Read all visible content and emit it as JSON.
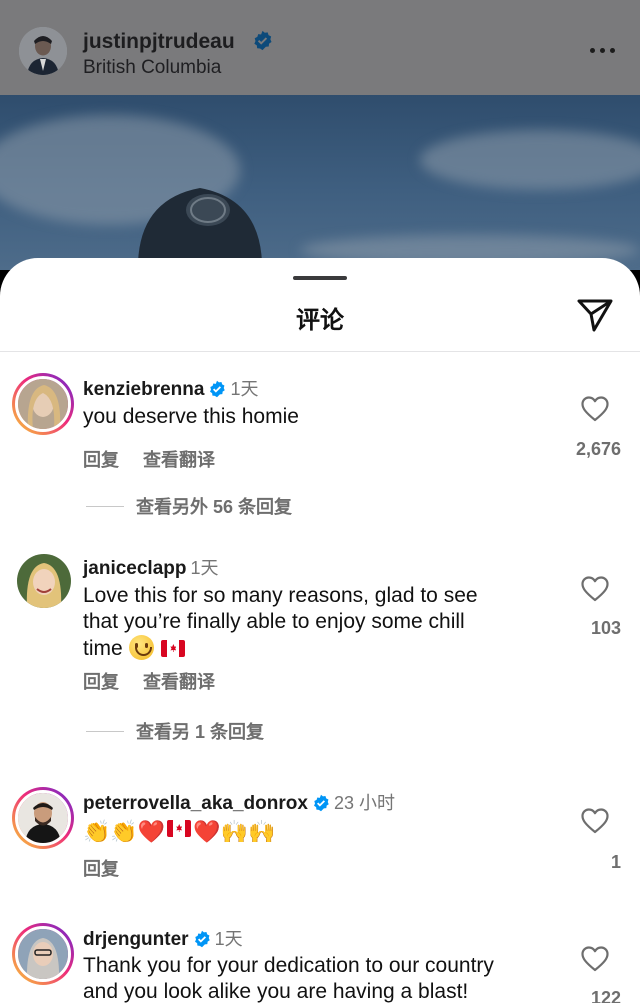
{
  "post": {
    "username": "justinpjtrudeau",
    "location": "British Columbia"
  },
  "sheet": {
    "title": "评论"
  },
  "comments": [
    {
      "username": "kenziebrenna",
      "verified": true,
      "time": "1天",
      "text": "you deserve this homie",
      "reply_label": "回复",
      "translate_label": "查看翻译",
      "likes": "2,676",
      "view_replies": "查看另外 56 条回复"
    },
    {
      "username": "janiceclapp",
      "verified": false,
      "time": "1天",
      "text_line1": "Love this for so many reasons, glad to see",
      "text_line2": "that you’re finally able to enjoy some chill",
      "text_line3": "time",
      "reply_label": "回复",
      "translate_label": "查看翻译",
      "likes": "103",
      "view_replies": "查看另 1 条回复"
    },
    {
      "username": "peterrovella_aka_donrox",
      "verified": true,
      "time": "23 小时",
      "emojis": [
        "👏",
        "👏",
        "❤️",
        "🇨🇦",
        "❤️",
        "🙌",
        "🙌"
      ],
      "reply_label": "回复",
      "likes": "1"
    },
    {
      "username": "drjengunter",
      "verified": true,
      "time": "1天",
      "text_line1": "Thank you for your dedication to our country",
      "text_line2": "and you look alike you are having a blast!",
      "likes": "122"
    }
  ],
  "colors": {
    "verified": "#0095f6",
    "story_ring_start": "#f9ce34",
    "story_ring_end": "#6228d7",
    "heart_red": "#e21b2b"
  },
  "icons": [
    "more-icon",
    "verified-icon",
    "share-icon",
    "heart-icon",
    "smiley-emoji",
    "canada-flag-emoji",
    "clap-emoji",
    "raised-hands-emoji"
  ]
}
